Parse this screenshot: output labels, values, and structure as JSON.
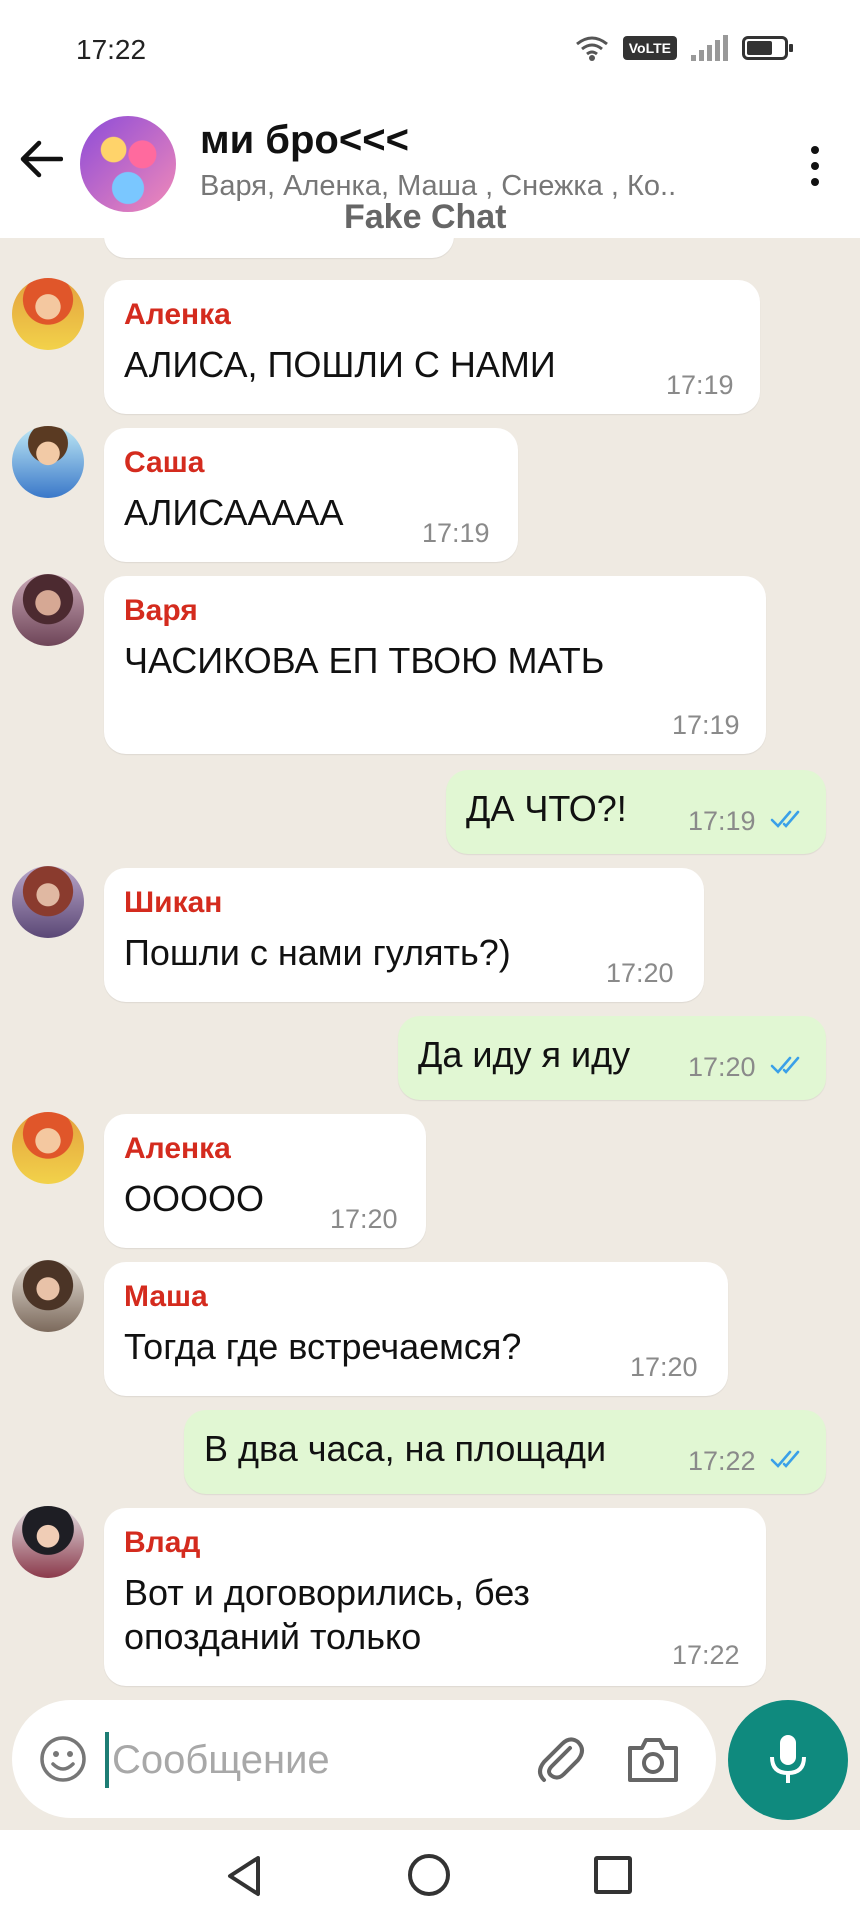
{
  "status_bar": {
    "time": "17:22",
    "volte": "VoLTE"
  },
  "header": {
    "title": "ми бро<<<",
    "members": "Варя, Аленка, Маша , Снежка , Ко..",
    "watermark": "Fake Chat"
  },
  "messages": [
    {
      "direction": "in",
      "sender": "Аленка",
      "text": "АЛИСА, ПОШЛИ С НАМИ",
      "time": "17:19"
    },
    {
      "direction": "in",
      "sender": "Саша",
      "text": "АЛИСААААА",
      "time": "17:19"
    },
    {
      "direction": "in",
      "sender": "Варя",
      "text": "ЧАСИКОВА ЕП ТВОЮ МАТЬ",
      "time": "17:19"
    },
    {
      "direction": "out",
      "text": "ДА ЧТО?!",
      "time": "17:19",
      "read": true
    },
    {
      "direction": "in",
      "sender": "Шикан",
      "text": "Пошли с нами гулять?)",
      "time": "17:20"
    },
    {
      "direction": "out",
      "text": "Да иду я иду",
      "time": "17:20",
      "read": true
    },
    {
      "direction": "in",
      "sender": "Аленка",
      "text": "ООООО",
      "time": "17:20"
    },
    {
      "direction": "in",
      "sender": "Маша",
      "text": "Тогда где встречаемся?",
      "time": "17:20"
    },
    {
      "direction": "out",
      "text": "В два часа, на площади",
      "time": "17:22",
      "read": true
    },
    {
      "direction": "in",
      "sender": "Влад",
      "text": "Вот и договорились, без",
      "text2": "опозданий только",
      "time": "17:22"
    }
  ],
  "input": {
    "placeholder": "Сообщение",
    "value": ""
  },
  "colors": {
    "accent": "#0f8a7e",
    "sender_name": "#d42b1e",
    "outgoing_bubble": "#e1f7d3",
    "read_check": "#3aa0e8"
  },
  "icons": [
    "back-arrow-icon",
    "more-vert-icon",
    "emoji-icon",
    "attach-icon",
    "camera-icon",
    "mic-icon",
    "double-check-icon"
  ]
}
